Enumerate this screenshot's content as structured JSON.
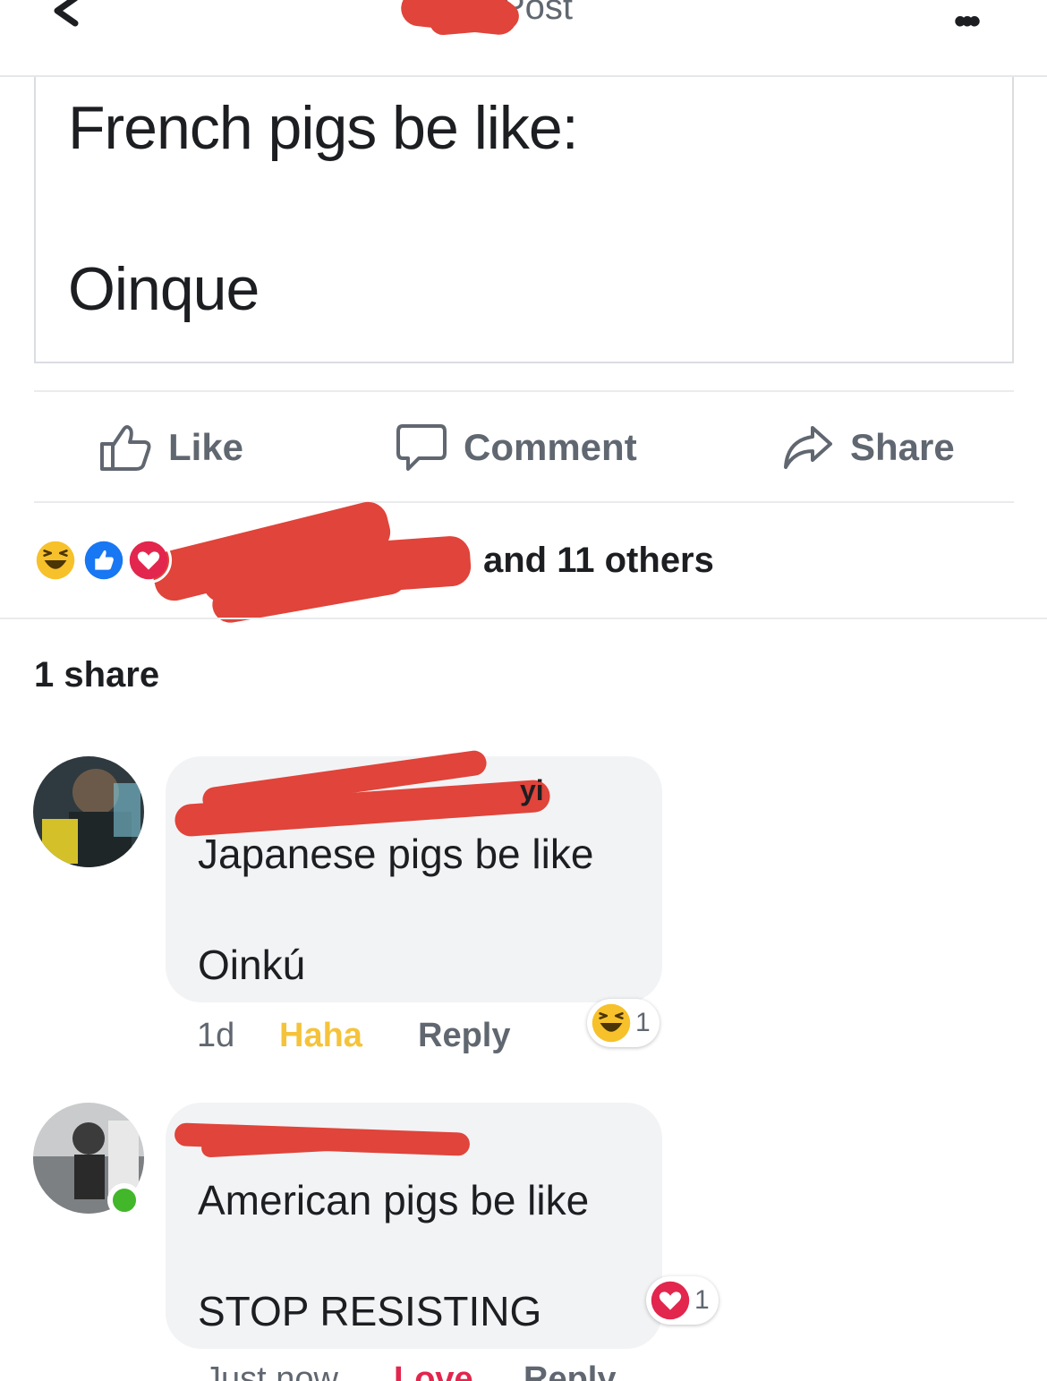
{
  "header": {
    "title": "Post",
    "back_icon": "chevron-left-icon",
    "more_icon": "more-dots-icon",
    "more_label": "•••"
  },
  "post": {
    "line1": "French pigs be like:",
    "line2": "Oinque"
  },
  "actions": {
    "like": "Like",
    "comment": "Comment",
    "share": "Share"
  },
  "reactions": {
    "icons": [
      "haha",
      "like",
      "love"
    ],
    "others_text": "and 11 others"
  },
  "shares_text": "1 share",
  "comments": [
    {
      "name_tail": "yi",
      "line1": "Japanese pigs be like",
      "line2": "Oinkú",
      "time": "1d",
      "reaction_label": "Haha",
      "reply_label": "Reply",
      "badge_icon": "haha",
      "badge_count": "1"
    },
    {
      "line1": "American pigs be like",
      "line2": "STOP RESISTING",
      "time": "Just now",
      "reaction_label": "Love",
      "reply_label": "Reply",
      "badge_icon": "love",
      "badge_count": "1",
      "online": true
    }
  ],
  "colors": {
    "haha": "#f7c12b",
    "love": "#e2264d",
    "like": "#1877f2",
    "muted": "#606770",
    "redaction": "#e0443a"
  }
}
